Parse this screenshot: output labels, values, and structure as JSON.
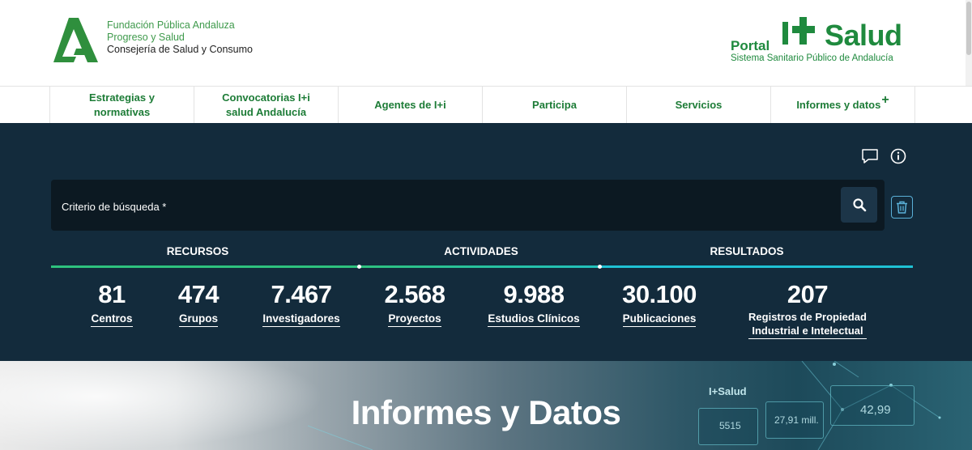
{
  "header": {
    "org_line1": "Fundación Pública Andaluza",
    "org_line2": "Progreso y Salud",
    "org_line3": "Consejería de Salud y Consumo",
    "portal_word": "Portal",
    "salud_word": "Salud",
    "portal_subtitle": "Sistema Sanitario Público de Andalucía"
  },
  "nav": {
    "items": [
      {
        "label_line1": "Estrategias y",
        "label_line2": "normativas"
      },
      {
        "label_line1": "Convocatorias I+i",
        "label_line2": "salud Andalucía"
      },
      {
        "label": "Agentes de I+i"
      },
      {
        "label": "Participa"
      },
      {
        "label": "Servicios"
      },
      {
        "label": "Informes y datos",
        "suffix": "+"
      }
    ]
  },
  "search": {
    "placeholder": "Criterio de búsqueda *",
    "value": ""
  },
  "categories": {
    "recursos": "RECURSOS",
    "actividades": "ACTIVIDADES",
    "resultados": "RESULTADOS"
  },
  "stats": [
    {
      "number": "81",
      "label": "Centros"
    },
    {
      "number": "474",
      "label": "Grupos"
    },
    {
      "number": "7.467",
      "label": "Investigadores"
    },
    {
      "number": "2.568",
      "label": "Proyectos"
    },
    {
      "number": "9.988",
      "label": "Estudios Clínicos"
    },
    {
      "number": "30.100",
      "label": "Publicaciones"
    },
    {
      "number": "207",
      "label_line1": "Registros de Propiedad",
      "label_line2": "Industrial e Intelectual"
    }
  ],
  "hero": {
    "title": "Informes y Datos",
    "dashboard_values": [
      "5515",
      "27,91 mill.",
      "42,99"
    ]
  },
  "icons": {
    "comment": "comment-icon",
    "info": "info-icon",
    "search": "search-icon",
    "trash": "trash-icon"
  },
  "colors": {
    "brand_green": "#1f8a3e",
    "panel_bg": "#132b3c",
    "search_bg": "#0c1922",
    "line_green": "#2ec27e",
    "line_cyan": "#1fc2d4"
  }
}
